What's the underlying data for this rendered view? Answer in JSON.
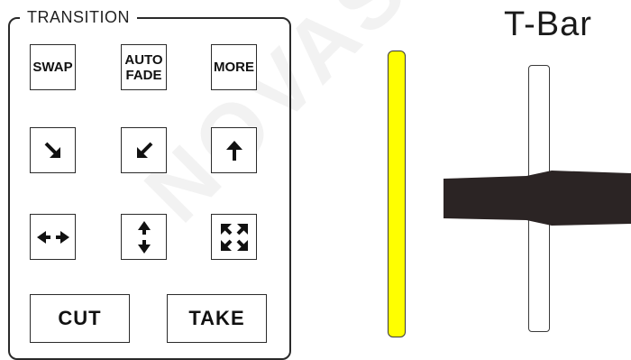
{
  "transition": {
    "title": "TRANSITION",
    "swap_label": "SWAP",
    "auto_fade_line1": "AUTO",
    "auto_fade_line2": "FADE",
    "more_label": "MORE",
    "cut_label": "CUT",
    "take_label": "TAKE"
  },
  "tbar": {
    "label": "T-Bar",
    "lamp_color": "#ffff00"
  },
  "watermark": {
    "text": "NOVASTAR"
  },
  "icons": [
    "arrow-down-right-icon",
    "arrow-down-left-icon",
    "arrow-up-icon",
    "arrow-horizontal-icon",
    "arrow-vertical-icon",
    "expand-corners-icon"
  ]
}
